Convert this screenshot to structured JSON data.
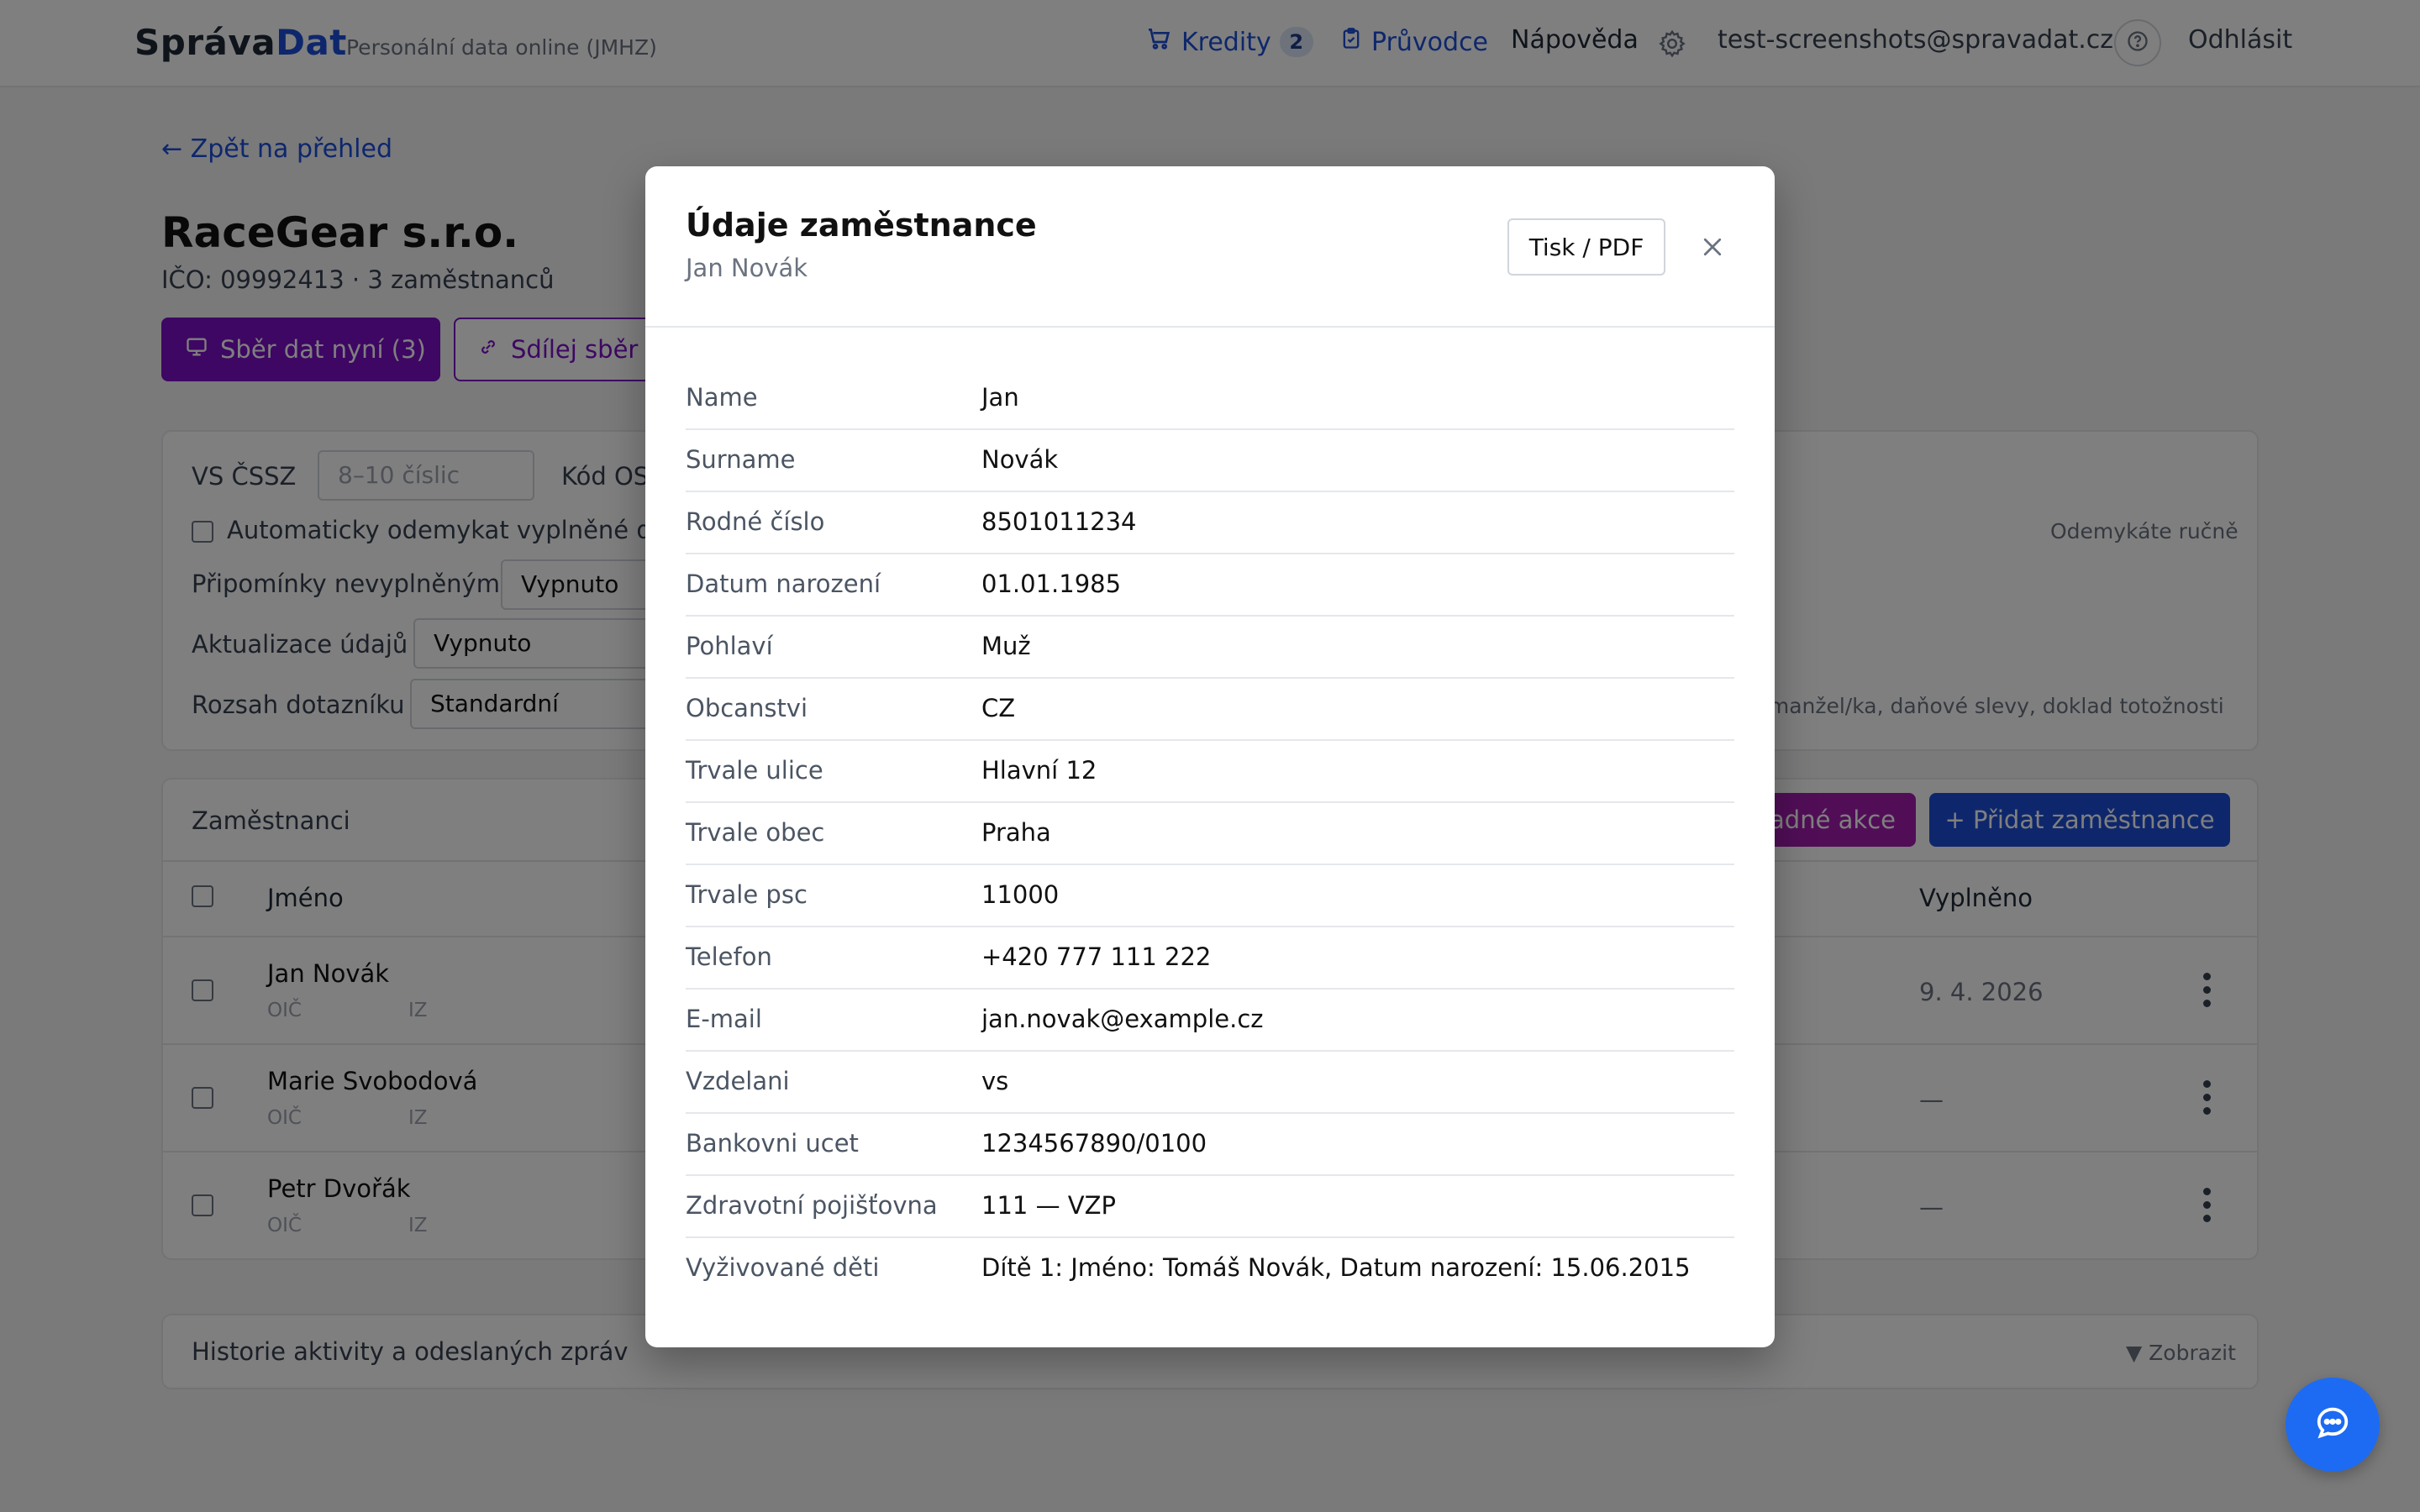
{
  "header": {
    "logo_a": "Správa",
    "logo_b": "Dat",
    "tagline": "Personální data online (JMHZ)",
    "credits_label": "Kredity",
    "credits_count": "2",
    "guide_label": "Průvodce",
    "help_label": "Nápověda",
    "user_email": "test-screenshots@spravadat.cz",
    "logout_label": "Odhlásit"
  },
  "page": {
    "back_link": "← Zpět na přehled",
    "company_name": "RaceGear s.r.o.",
    "company_sub": "IČO: 09992413 · 3 zaměstnanců",
    "collect_button": "Sběr dat nyní  (3)",
    "share_button": "Sdílej sběr d"
  },
  "settings": {
    "vs_label": "VS ČSSZ",
    "vs_placeholder": "8–10 číslic",
    "kod_label": "Kód OS",
    "auto_unlock_label": "Automaticky odemykat vyplněné do",
    "auto_unlock_hint": "Odemykáte ručně",
    "reminders_label": "Připomínky nevyplněným",
    "reminders_value": "Vypnuto",
    "updates_label": "Aktualizace údajů",
    "updates_value": "Vypnuto",
    "scope_label": "Rozsah dotazníku",
    "scope_value": "Standardní",
    "scope_hint": "i, manžel/ka, daňové slevy, doklad totožnosti"
  },
  "employees": {
    "title": "Zaměstnanci",
    "bulk_actions": "adné akce",
    "add_button": "+ Přidat zaměstnance",
    "col_name": "Jméno",
    "col_filled": "Vyplněno",
    "oic_label": "OIČ",
    "iz_label": "IZ",
    "rows": [
      {
        "name": "Jan Novák",
        "filled": "9. 4. 2026"
      },
      {
        "name": "Marie Svobodová",
        "filled": "—"
      },
      {
        "name": "Petr Dvořák",
        "filled": "—"
      }
    ]
  },
  "history": {
    "title": "Historie aktivity a odeslaných zpráv",
    "toggle": "▼ Zobrazit"
  },
  "modal": {
    "title": "Údaje zaměstnance",
    "subtitle": "Jan Novák",
    "print_button": "Tisk / PDF",
    "fields": [
      {
        "key": "Name",
        "value": "Jan"
      },
      {
        "key": "Surname",
        "value": "Novák"
      },
      {
        "key": "Rodné číslo",
        "value": "8501011234"
      },
      {
        "key": "Datum narození",
        "value": "01.01.1985"
      },
      {
        "key": "Pohlaví",
        "value": "Muž"
      },
      {
        "key": "Obcanstvi",
        "value": "CZ"
      },
      {
        "key": "Trvale ulice",
        "value": "Hlavní 12"
      },
      {
        "key": "Trvale obec",
        "value": "Praha"
      },
      {
        "key": "Trvale psc",
        "value": "11000"
      },
      {
        "key": "Telefon",
        "value": "+420 777 111 222"
      },
      {
        "key": "E-mail",
        "value": "jan.novak@example.cz"
      },
      {
        "key": "Vzdelani",
        "value": "vs"
      },
      {
        "key": "Bankovni ucet",
        "value": "1234567890/0100"
      },
      {
        "key": "Zdravotní pojišťovna",
        "value": "111 — VZP"
      },
      {
        "key": "Vyživované děti",
        "value": "Dítě 1: Jméno: Tomáš Novák, Datum narození: 15.06.2015"
      }
    ]
  },
  "colors": {
    "brand_blue": "#1d4ed8",
    "brand_purple": "#7c0ec7",
    "chat_blue": "#1d6bf3"
  }
}
